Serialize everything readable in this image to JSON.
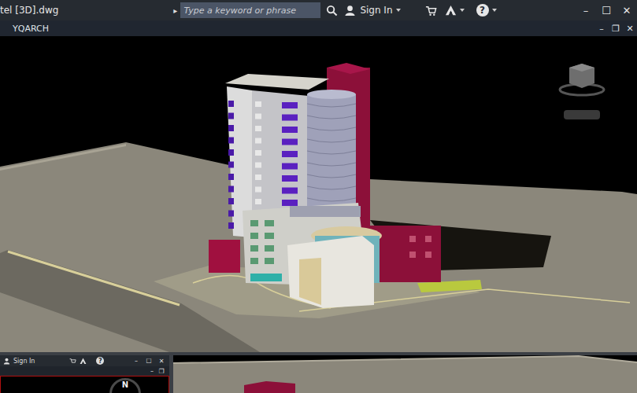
{
  "window": {
    "title": "tel [3D].dwg",
    "controls": [
      "–",
      "☐",
      "✕"
    ]
  },
  "search": {
    "expander": "▸",
    "placeholder": "Type a keyword or phrase"
  },
  "account": {
    "label": "Sign In"
  },
  "help": {
    "label": "?"
  },
  "document_tab": {
    "label": "YQARCH",
    "controls": [
      "–",
      "❐",
      "✕"
    ]
  },
  "lower_window": {
    "account": {
      "label": "Sign In"
    },
    "help": {
      "label": "?"
    },
    "controls": [
      "–",
      "☐",
      "✕"
    ],
    "inner_controls": [
      "–",
      "❐"
    ],
    "compass": "N"
  }
}
